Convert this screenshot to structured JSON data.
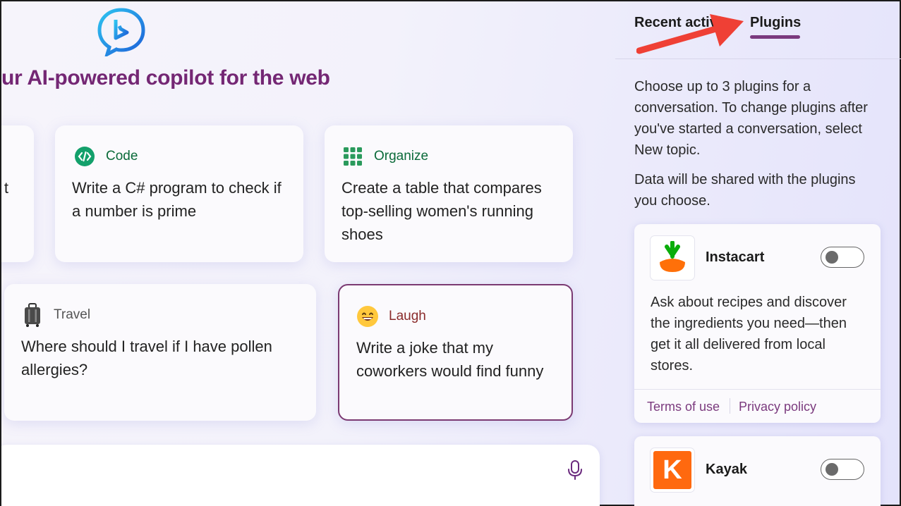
{
  "headline": "ur AI-powered copilot for the web",
  "cards": [
    {
      "category": "Code",
      "icon": "code-icon",
      "text": "Write a C# program to check if a number is prime",
      "color": "#0b6b3a"
    },
    {
      "category": "Organize",
      "icon": "grid-icon",
      "text": "Create a table that compares top-selling women's running shoes",
      "color": "#0b6b3a"
    },
    {
      "category": "Travel",
      "icon": "luggage-icon",
      "text": "Where should I travel if I have pollen allergies?",
      "color": "#555555"
    },
    {
      "category": "Laugh",
      "icon": "grinning-face-icon",
      "text": "Write a joke that my coworkers would find funny",
      "color": "#8a2b2b"
    }
  ],
  "partial_card_text": "t",
  "sidebar": {
    "tabs": [
      {
        "label": "Recent activity",
        "active": false
      },
      {
        "label": "Plugins",
        "active": true
      }
    ],
    "intro": "Choose up to 3 plugins for a conversation. To change plugins after you've started a conversation, select New topic.",
    "share_note": "Data will be shared with the plugins you choose.",
    "plugins": [
      {
        "name": "Instacart",
        "icon": "instacart-carrot-icon",
        "enabled": false,
        "description": "Ask about recipes and discover the ingredients you need—then get it all delivered from local stores.",
        "terms": "Terms of use",
        "privacy": "Privacy policy"
      },
      {
        "name": "Kayak",
        "icon": "kayak-k-icon",
        "enabled": false
      }
    ]
  },
  "colors": {
    "accent": "#742774",
    "tab_underline": "#7b3a7e",
    "arrow": "#ef4035"
  }
}
